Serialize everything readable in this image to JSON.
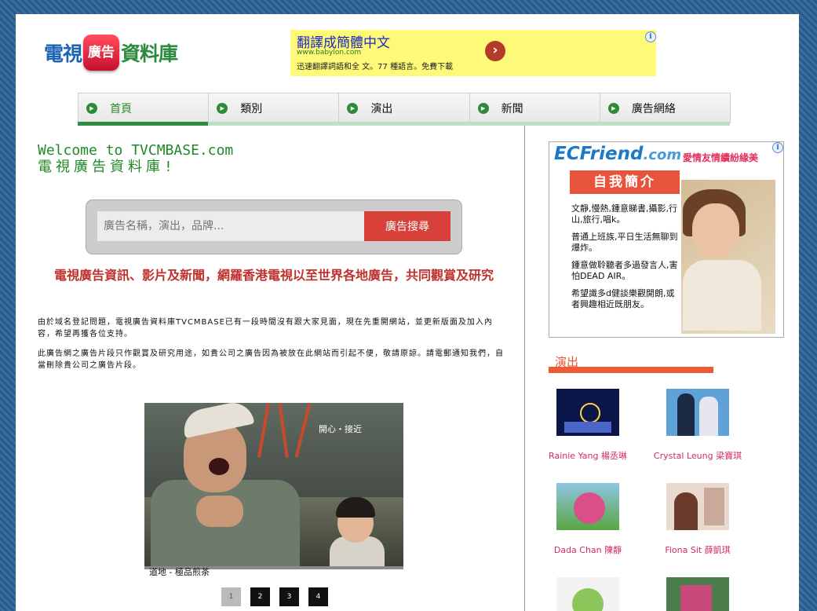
{
  "logo": {
    "part1": "電視",
    "badge": "廣告",
    "part2": "資料庫"
  },
  "top_ad": {
    "headline": "翻譯成簡體中文",
    "url": "www.babylon.com",
    "description": "迅速翻譯詞語和全 文。77 種語言。免費下載",
    "info_glyph": "i"
  },
  "nav": {
    "items": [
      {
        "label": "首頁",
        "icon": "play-circle-icon"
      },
      {
        "label": "類別",
        "icon": "play-circle-icon"
      },
      {
        "label": "演出",
        "icon": "play-circle-icon"
      },
      {
        "label": "新聞",
        "icon": "play-circle-icon"
      },
      {
        "label": "廣告網絡",
        "icon": "play-circle-icon"
      }
    ],
    "active_index": 0
  },
  "welcome": {
    "line1": "Welcome to TVCMBASE.com",
    "line2": "電視廣告資料庫!"
  },
  "search": {
    "placeholder": "廣告名稱，演出，品牌...",
    "button": "廣告搜尋"
  },
  "tagline": "電視廣告資訊、影片及新聞，網羅香港電視以至世界各地廣告，共同觀賞及研究",
  "intro": {
    "p1": "由於域名登記問題，電視廣告資料庫TVCMBASE已有一段時間沒有跟大家見面，現在先重開網站，並更新版面及加入內容，希望再獲各位支持。",
    "p2": "此廣告網之廣告片段只作觀賞及研究用途，如貴公司之廣告因為被放在此網站而引起不便，敬請原諒。請電郵通知我們，自當刪除貴公司之廣告片段。"
  },
  "featured_video": {
    "overlay_text": "開心・接近",
    "title": "道地 - 極品煎茶"
  },
  "pager": {
    "pages": [
      "1",
      "2",
      "3",
      "4"
    ],
    "current": "1"
  },
  "right_ad": {
    "brand": "ECFriend",
    "brand_suffix": ".com",
    "slogan": "愛情友情續紛緣美",
    "header": "自我簡介",
    "lines": [
      "文靜,慢熱,鍾意睇書,攝影,行山,旅行,唱k。",
      "普通上班族,平日生活無聊到爆炸。",
      "鍾意做聆聽者多過發言人,害怕DEAD AIR。",
      "希望識多d健談樂觀開朗,或者興趣相近既朋友。"
    ]
  },
  "performers": {
    "heading": "演出",
    "items": [
      {
        "name": "Rainie Yang 楊丞琳"
      },
      {
        "name": "Crystal Leung 梁寶琪"
      },
      {
        "name": "Dada Chan 陳靜"
      },
      {
        "name": "Fiona Sit 薛凱琪"
      },
      {
        "name": ""
      },
      {
        "name": ""
      }
    ]
  },
  "colors": {
    "accent_green": "#2f8a44",
    "tagline_red": "#c0312e",
    "search_button": "#d9403a",
    "performer_name": "#d22a66",
    "section_bar": "#ec5b34"
  }
}
